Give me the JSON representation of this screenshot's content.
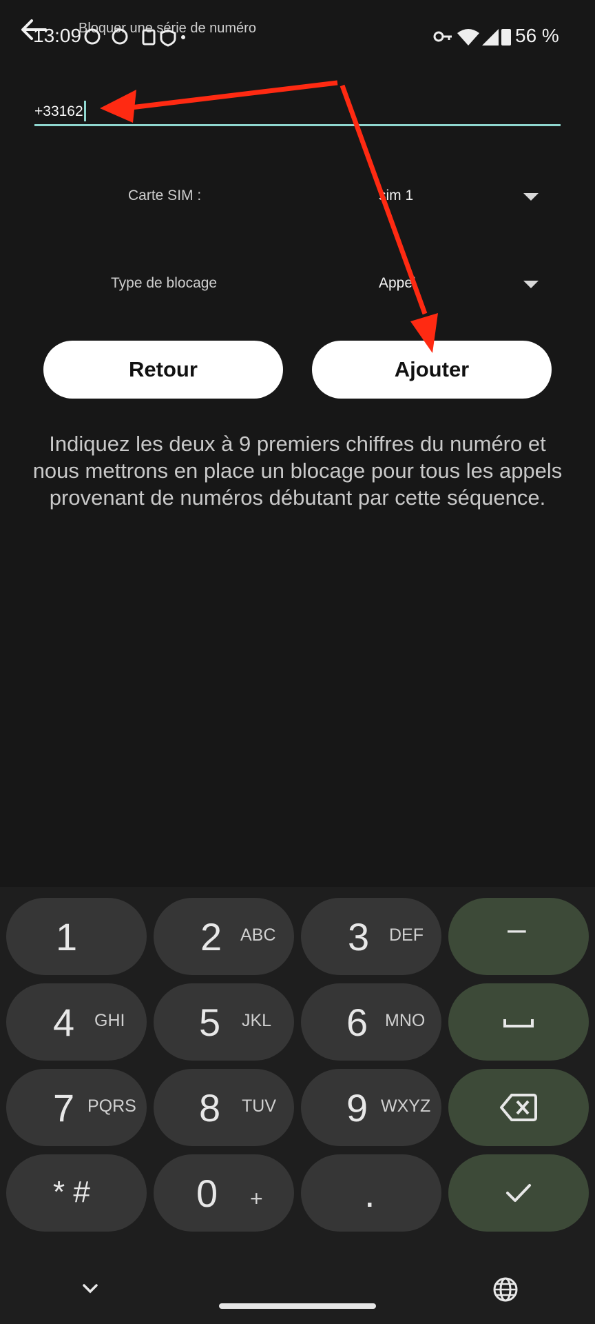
{
  "status": {
    "time": "13:09",
    "battery": "56 %"
  },
  "appbar": {
    "title": "Bloquer une série de numéro"
  },
  "form": {
    "number_value": "+33162",
    "sim_label": "Carte SIM :",
    "sim_value": "sim 1",
    "block_type_label": "Type de blocage",
    "block_type_value": "Appel"
  },
  "buttons": {
    "back_label": "Retour",
    "add_label": "Ajouter"
  },
  "info_text": "Indiquez les deux à 9 premiers chiffres du numéro et nous mettrons en place un blocage pour tous les appels provenant de numéros débutant par cette séquence.",
  "keyboard": {
    "keys": [
      {
        "digit": "1",
        "letters": ""
      },
      {
        "digit": "2",
        "letters": "ABC"
      },
      {
        "digit": "3",
        "letters": "DEF"
      },
      {
        "digit": "4",
        "letters": "GHI"
      },
      {
        "digit": "5",
        "letters": "JKL"
      },
      {
        "digit": "6",
        "letters": "MNO"
      },
      {
        "digit": "7",
        "letters": "PQRS"
      },
      {
        "digit": "8",
        "letters": "TUV"
      },
      {
        "digit": "9",
        "letters": "WXYZ"
      },
      {
        "digit": "* #",
        "letters": ""
      },
      {
        "digit": "0",
        "letters": "+"
      },
      {
        "digit": ".",
        "letters": ""
      }
    ],
    "minus": "–"
  },
  "colors": {
    "accent_teal": "#8fd6cf",
    "annotation_red": "#ff2a12",
    "green_key": "#3d4a38"
  }
}
